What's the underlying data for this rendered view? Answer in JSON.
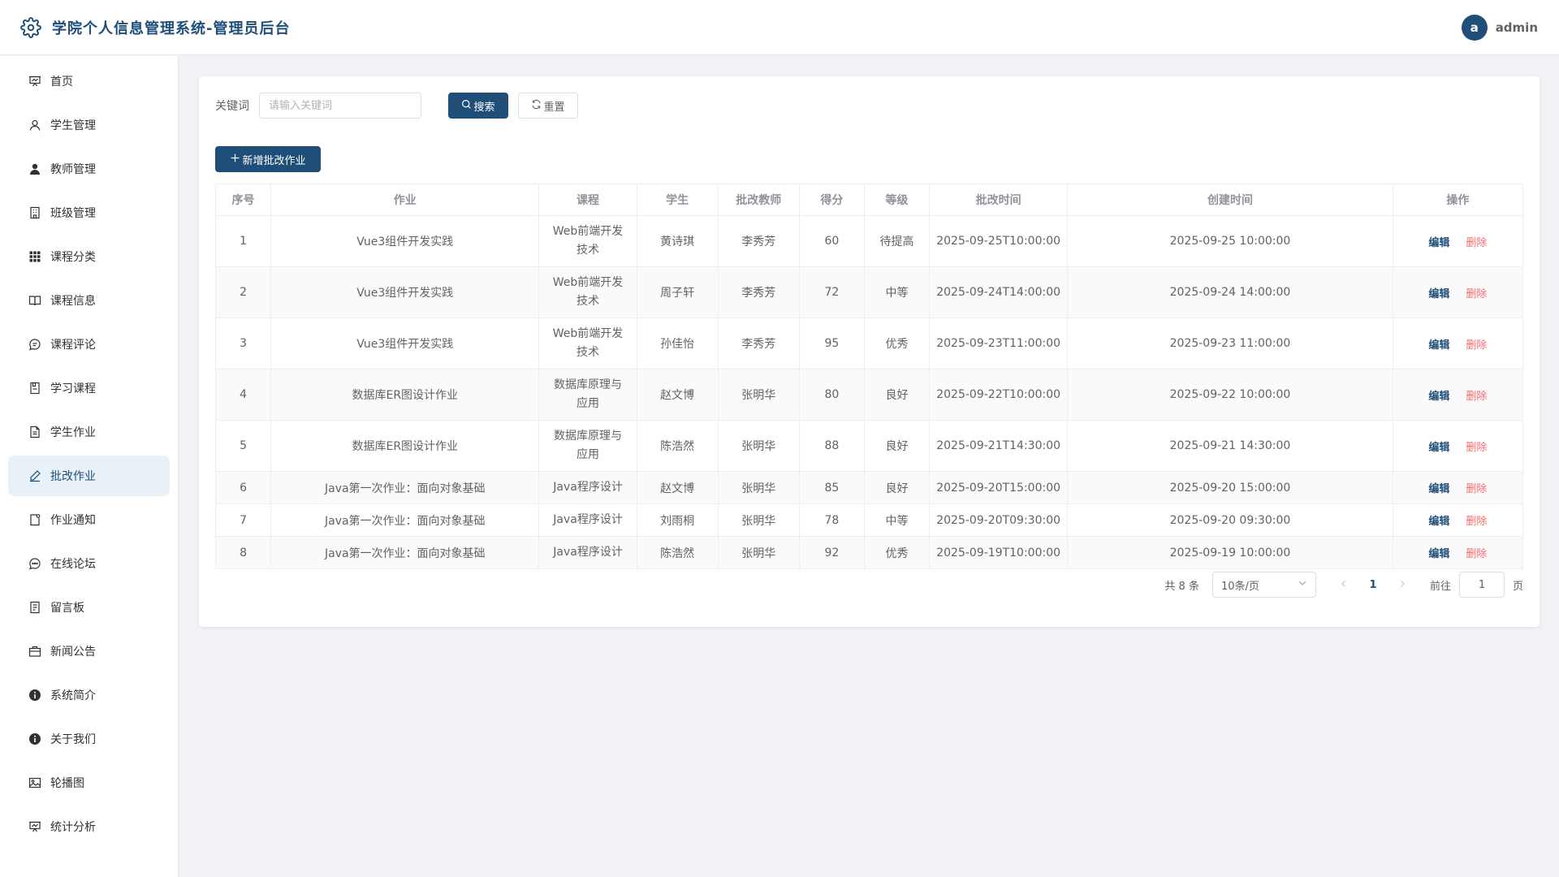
{
  "header": {
    "title": "学院个人信息管理系统-管理员后台",
    "avatar_letter": "a",
    "username": "admin"
  },
  "sidebar": {
    "items": [
      {
        "label": "首页",
        "icon": "presentation-icon"
      },
      {
        "label": "学生管理",
        "icon": "user-outline-icon"
      },
      {
        "label": "教师管理",
        "icon": "user-filled-icon"
      },
      {
        "label": "班级管理",
        "icon": "building-icon"
      },
      {
        "label": "课程分类",
        "icon": "grid-icon"
      },
      {
        "label": "课程信息",
        "icon": "book-icon"
      },
      {
        "label": "课程评论",
        "icon": "chat-icon"
      },
      {
        "label": "学习课程",
        "icon": "notebook-icon"
      },
      {
        "label": "学生作业",
        "icon": "document-icon"
      },
      {
        "label": "批改作业",
        "icon": "edit-pen-icon",
        "active": true
      },
      {
        "label": "作业通知",
        "icon": "notice-icon"
      },
      {
        "label": "在线论坛",
        "icon": "chat-dots-icon"
      },
      {
        "label": "留言板",
        "icon": "memo-icon"
      },
      {
        "label": "新闻公告",
        "icon": "briefcase-icon"
      },
      {
        "label": "系统简介",
        "icon": "info-icon"
      },
      {
        "label": "关于我们",
        "icon": "info-icon"
      },
      {
        "label": "轮播图",
        "icon": "picture-icon"
      },
      {
        "label": "统计分析",
        "icon": "presentation-icon"
      }
    ]
  },
  "search": {
    "label": "关键词",
    "placeholder": "请输入关键词",
    "search_button": "搜索",
    "reset_button": "重置"
  },
  "add_button": "新增批改作业",
  "table": {
    "headers": [
      "序号",
      "作业",
      "课程",
      "学生",
      "批改教师",
      "得分",
      "等级",
      "批改时间",
      "创建时间",
      "操作"
    ],
    "edit_label": "编辑",
    "delete_label": "删除",
    "rows": [
      {
        "no": "1",
        "homework": "Vue3组件开发实践",
        "course_l1": "Web前端开发",
        "course_l2": "技术",
        "student": "黄诗琪",
        "teacher": "李秀芳",
        "score": "60",
        "level": "待提高",
        "graded_at": "2025-09-25T10:00:00",
        "created_at": "2025-09-25 10:00:00"
      },
      {
        "no": "2",
        "homework": "Vue3组件开发实践",
        "course_l1": "Web前端开发",
        "course_l2": "技术",
        "student": "周子轩",
        "teacher": "李秀芳",
        "score": "72",
        "level": "中等",
        "graded_at": "2025-09-24T14:00:00",
        "created_at": "2025-09-24 14:00:00"
      },
      {
        "no": "3",
        "homework": "Vue3组件开发实践",
        "course_l1": "Web前端开发",
        "course_l2": "技术",
        "student": "孙佳怡",
        "teacher": "李秀芳",
        "score": "95",
        "level": "优秀",
        "graded_at": "2025-09-23T11:00:00",
        "created_at": "2025-09-23 11:00:00"
      },
      {
        "no": "4",
        "homework": "数据库ER图设计作业",
        "course_l1": "数据库原理与",
        "course_l2": "应用",
        "student": "赵文博",
        "teacher": "张明华",
        "score": "80",
        "level": "良好",
        "graded_at": "2025-09-22T10:00:00",
        "created_at": "2025-09-22 10:00:00"
      },
      {
        "no": "5",
        "homework": "数据库ER图设计作业",
        "course_l1": "数据库原理与",
        "course_l2": "应用",
        "student": "陈浩然",
        "teacher": "张明华",
        "score": "88",
        "level": "良好",
        "graded_at": "2025-09-21T14:30:00",
        "created_at": "2025-09-21 14:30:00"
      },
      {
        "no": "6",
        "homework": "Java第一次作业：面向对象基础",
        "course_l1": "Java程序设计",
        "course_l2": "",
        "student": "赵文博",
        "teacher": "张明华",
        "score": "85",
        "level": "良好",
        "graded_at": "2025-09-20T15:00:00",
        "created_at": "2025-09-20 15:00:00"
      },
      {
        "no": "7",
        "homework": "Java第一次作业：面向对象基础",
        "course_l1": "Java程序设计",
        "course_l2": "",
        "student": "刘雨桐",
        "teacher": "张明华",
        "score": "78",
        "level": "中等",
        "graded_at": "2025-09-20T09:30:00",
        "created_at": "2025-09-20 09:30:00"
      },
      {
        "no": "8",
        "homework": "Java第一次作业：面向对象基础",
        "course_l1": "Java程序设计",
        "course_l2": "",
        "student": "陈浩然",
        "teacher": "张明华",
        "score": "92",
        "level": "优秀",
        "graded_at": "2025-09-19T10:00:00",
        "created_at": "2025-09-19 10:00:00"
      }
    ]
  },
  "pagination": {
    "total": "共 8 条",
    "page_size": "10条/页",
    "current_page": "1",
    "goto_label": "前往",
    "goto_value": "1",
    "page_suffix": "页"
  },
  "colors": {
    "primary": "#1f4e79",
    "danger": "#f56c6c",
    "active_bg": "#e8f0f8"
  }
}
